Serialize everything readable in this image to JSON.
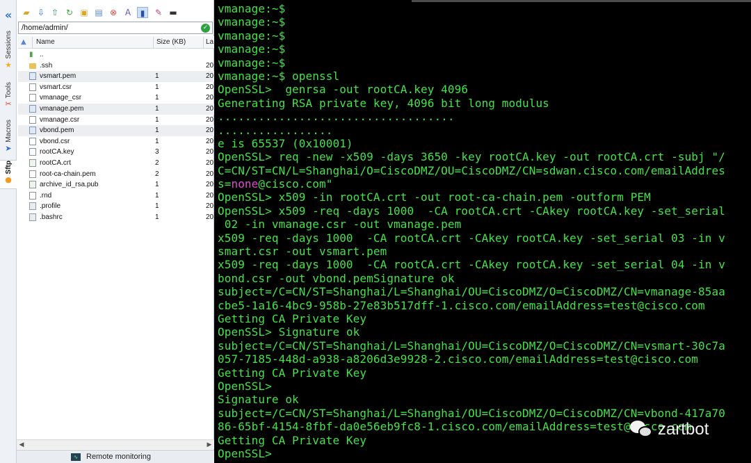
{
  "sidebar_tabs": [
    {
      "label": "Sessions",
      "icon": "star-icon"
    },
    {
      "label": "Tools",
      "icon": "tools-icon"
    },
    {
      "label": "Macros",
      "icon": "macros-icon"
    },
    {
      "label": "Sftp",
      "icon": "sftp-icon"
    }
  ],
  "sftp": {
    "path": "/home/admin/",
    "columns": {
      "name": "Name",
      "size": "Size (KB)",
      "date": "La"
    },
    "files": [
      {
        "name": "..",
        "size": "",
        "date": "",
        "type": "up"
      },
      {
        "name": ".ssh",
        "size": "",
        "date": "20",
        "type": "folder"
      },
      {
        "name": "vsmart.pem",
        "size": "1",
        "date": "20",
        "type": "cert"
      },
      {
        "name": "vsmart.csr",
        "size": "1",
        "date": "20",
        "type": "file"
      },
      {
        "name": "vmanage_csr",
        "size": "1",
        "date": "20",
        "type": "file"
      },
      {
        "name": "vmanage.pem",
        "size": "1",
        "date": "20",
        "type": "cert"
      },
      {
        "name": "vmanage.csr",
        "size": "1",
        "date": "20",
        "type": "file"
      },
      {
        "name": "vbond.pem",
        "size": "1",
        "date": "20",
        "type": "cert"
      },
      {
        "name": "vbond.csr",
        "size": "1",
        "date": "20",
        "type": "file"
      },
      {
        "name": "rootCA.key",
        "size": "3",
        "date": "20",
        "type": "file"
      },
      {
        "name": "rootCA.crt",
        "size": "2",
        "date": "20",
        "type": "key"
      },
      {
        "name": "root-ca-chain.pem",
        "size": "2",
        "date": "20",
        "type": "file"
      },
      {
        "name": "archive_id_rsa.pub",
        "size": "1",
        "date": "20",
        "type": "key"
      },
      {
        "name": ".rnd",
        "size": "1",
        "date": "20",
        "type": "file"
      },
      {
        "name": ".profile",
        "size": "1",
        "date": "20",
        "type": "cfg"
      },
      {
        "name": ".bashrc",
        "size": "1",
        "date": "20",
        "type": "cfg"
      }
    ],
    "remote_monitoring": "Remote monitoring"
  },
  "terminal": {
    "lines": [
      "vmanage:~$",
      "vmanage:~$",
      "vmanage:~$",
      "vmanage:~$",
      "vmanage:~$",
      "vmanage:~$ openssl",
      "OpenSSL>  genrsa -out rootCA.key 4096",
      "Generating RSA private key, 4096 bit long modulus",
      "...................................",
      ".................",
      "e is 65537 (0x10001)",
      "OpenSSL> req -new -x509 -days 3650 -key rootCA.key -out rootCA.crt -subj \"/",
      "C=CN/ST=CN/L=Shanghai/O=CiscoDMZ/OU=CiscoDMZ/CN=sdwan.cisco.com/emailAddres",
      "s=none@cisco.com\"",
      "OpenSSL> x509 -in rootCA.crt -out root-ca-chain.pem -outform PEM",
      "OpenSSL> x509 -req -days 1000  -CA rootCA.crt -CAkey rootCA.key -set_serial",
      " 02 -in vmanage.csr -out vmanage.pem",
      "x509 -req -days 1000  -CA rootCA.crt -CAkey rootCA.key -set_serial 03 -in v",
      "smart.csr -out vsmart.pem",
      "x509 -req -days 1000  -CA rootCA.crt -CAkey rootCA.key -set_serial 04 -in v",
      "bond.csr -out vbond.pemSignature ok",
      "subject=/C=CN/ST=Shanghai/L=Shanghai/OU=CiscoDMZ/O=CiscoDMZ/CN=vmanage-85aa",
      "cbe5-1a16-4bc9-958b-27e83b517dff-1.cisco.com/emailAddress=test@cisco.com",
      "Getting CA Private Key",
      "OpenSSL> Signature ok",
      "subject=/C=CN/ST=Shanghai/L=Shanghai/OU=CiscoDMZ/O=CiscoDMZ/CN=vsmart-30c7a",
      "057-7185-448d-a938-a8206d3e9928-2.cisco.com/emailAddress=test@cisco.com",
      "Getting CA Private Key",
      "OpenSSL>",
      "Signature ok",
      "subject=/C=CN/ST=Shanghai/L=Shanghai/OU=CiscoDMZ/O=CiscoDMZ/CN=vbond-417a70",
      "86-65bf-4154-8fbf-da0e56eb9fc8-1.cisco.com/emailAddress=test@cisco.com",
      "Getting CA Private Key",
      "OpenSSL>"
    ],
    "highlight_word": "none",
    "highlight_line": 13
  },
  "watermark": "zartbot",
  "colors": {
    "terminal_bg": "#000000",
    "terminal_fg": "#45e24a",
    "highlight": "#e14ad6"
  }
}
